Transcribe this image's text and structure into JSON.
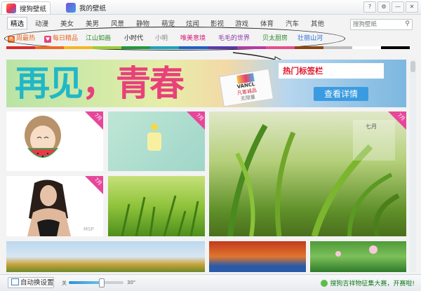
{
  "tabs": [
    {
      "label": "搜狗壁纸",
      "icon": "sogou-wallpaper-icon"
    },
    {
      "label": "我的壁纸",
      "icon": "my-wallpaper-icon"
    }
  ],
  "window_buttons": [
    {
      "label": "?",
      "icon": "help-icon"
    },
    {
      "label": "⚙",
      "icon": "settings-icon"
    },
    {
      "label": "—",
      "icon": "minimize-icon"
    },
    {
      "label": "✕",
      "icon": "close-icon"
    }
  ],
  "categories": [
    "精选",
    "动漫",
    "美女",
    "美男",
    "风景",
    "静物",
    "萌宠",
    "炫闻",
    "影视",
    "游戏",
    "体育",
    "汽车",
    "其他"
  ],
  "search": {
    "placeholder": "搜狗壁纸",
    "icon": "search-icon"
  },
  "hot_tags": [
    {
      "label": "周最热",
      "color": "#e8641b",
      "badge": "热",
      "badge_color": "#e8641b"
    },
    {
      "label": "每日精品",
      "color": "#e8641b",
      "badge": "♥",
      "badge_color": "#e8417a"
    },
    {
      "label": "江山如画",
      "color": "#2a8a2a"
    },
    {
      "label": "小时代",
      "color": "#222222"
    },
    {
      "label": "小明",
      "color": "#888888"
    },
    {
      "label": "唯美意境",
      "color": "#d61c7a"
    },
    {
      "label": "毛毛的世界",
      "color": "#8a3aa8"
    },
    {
      "label": "贝太厨房",
      "color": "#2a8a2a"
    },
    {
      "label": "壮丽山河",
      "color": "#2a6fd0"
    }
  ],
  "color_strip": [
    "#d92b2b",
    "#f26a21",
    "#f5b81c",
    "#9acd32",
    "#1e9a3c",
    "#1aa3b8",
    "#1e5fc8",
    "#5a36b0",
    "#b53aa3",
    "#e74c8c",
    "#8b4513",
    "#bcbcbc",
    "#ffffff",
    "#000000"
  ],
  "banner": {
    "title_left": "再见",
    "title_sep": "，",
    "title_right": "青春",
    "brand": "VANCL",
    "brand_sub": "凡客诚品",
    "brand_note": "无限量",
    "callout": "热门标签栏",
    "detail_button": "查看详情"
  },
  "tiles": [
    {
      "name": "tile-girl-watermelon",
      "corner": "7月"
    },
    {
      "name": "tile-mint-calendar",
      "corner": "7月"
    },
    {
      "name": "tile-grass-large",
      "corner": "7月",
      "calendar_label": "七月"
    },
    {
      "name": "tile-woman-portrait",
      "corner": "7月",
      "watermark": "MSP"
    },
    {
      "name": "tile-green-grass"
    },
    {
      "name": "tile-autumn-lake"
    },
    {
      "name": "tile-red-trees"
    },
    {
      "name": "tile-lotus"
    }
  ],
  "bottom": {
    "auto_button": "自动换设置",
    "slider_left": "关",
    "slider_right": "30\"",
    "slider_level": 0.6,
    "promo": "搜狗吉祥物征集大赛，开赛啦!"
  }
}
